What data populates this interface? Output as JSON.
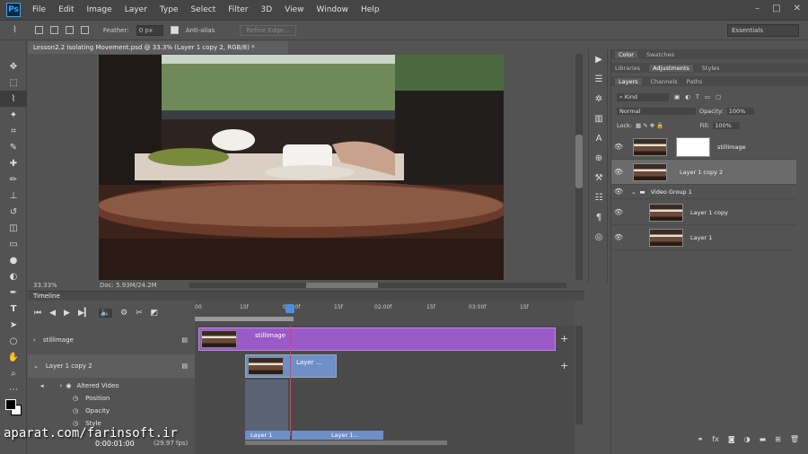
{
  "app": {
    "logo": "Ps"
  },
  "menu": [
    "File",
    "Edit",
    "Image",
    "Layer",
    "Type",
    "Select",
    "Filter",
    "3D",
    "View",
    "Window",
    "Help"
  ],
  "options": {
    "feather_label": "Feather:",
    "feather_value": "0 px",
    "antialias_label": "Anti-alias",
    "refine_label": "Refine Edge...",
    "workspace": "Essentials"
  },
  "document": {
    "tab": "Lesson2.2 Isolating Movement.psd @ 33.3% (Layer 1 copy 2, RGB/8) *",
    "zoom": "33.33%",
    "doc_size": "Doc: 5.93M/24.2M"
  },
  "timeline": {
    "title": "Timeline",
    "ruler": [
      "00",
      "15f",
      "01:00f",
      "15f",
      "02:00f",
      "15f",
      "03:00f",
      "15f"
    ],
    "tracks": [
      {
        "label": "stillimage"
      },
      {
        "label": "Layer 1 copy 2"
      }
    ],
    "props": [
      "Altered Video",
      "Position",
      "Opacity",
      "Style"
    ],
    "clips": {
      "still": "stillimage",
      "copy2": "Layer ...",
      "bottom1": "Layer 1",
      "bottom2": "Layer 1..."
    },
    "timecode": "0:00:01:00",
    "fps": "(29.97 fps)"
  },
  "panels": {
    "top_tabs": [
      "Color",
      "Swatches"
    ],
    "mid_tabs": [
      "Libraries",
      "Adjustments",
      "Styles"
    ],
    "layer_tabs": [
      "Layers",
      "Channels",
      "Paths"
    ],
    "kind": "Kind",
    "blend": "Normal",
    "opacity_label": "Opacity:",
    "opacity": "100%",
    "lock_label": "Lock:",
    "fill_label": "Fill:",
    "fill": "100%",
    "layers": [
      {
        "name": "stillimage"
      },
      {
        "name": "Layer 1 copy 2"
      },
      {
        "name": "Video Group 1"
      },
      {
        "name": "Layer 1 copy"
      },
      {
        "name": "Layer 1"
      }
    ]
  },
  "watermark": "aparat.com/farinsoft.ir",
  "colors": {
    "clip_purple": "#9a5ac8",
    "clip_blue": "#6f8fc8",
    "playhead": "#e04060"
  }
}
